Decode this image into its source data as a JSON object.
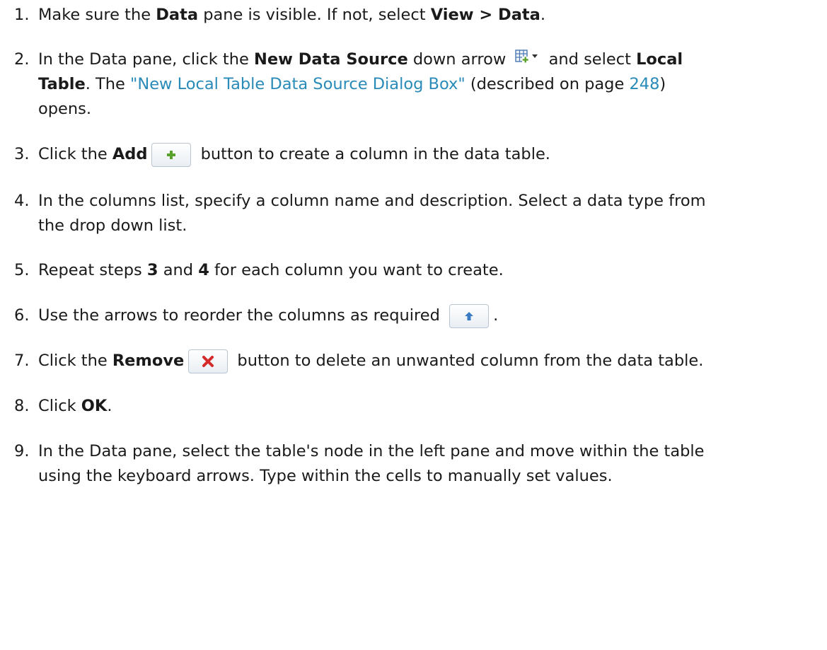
{
  "steps": [
    {
      "num": "1.",
      "a": "Make sure the ",
      "b": "Data",
      "c": " pane is visible. If not, select ",
      "d": "View > Data",
      "e": "."
    },
    {
      "num": "2.",
      "a": "In the Data pane, click the ",
      "b": "New Data Source",
      "c": " down arrow ",
      "d": " and select ",
      "e": "Local",
      "f": "Table",
      "g": ". The ",
      "link": "\"New Local Table Data Source Dialog Box\"",
      "h": " (described on page ",
      "page": "248",
      "i": ")",
      "j": "opens."
    },
    {
      "num": "3.",
      "a": "Click the ",
      "b": "Add",
      "c": " button to create a column in the data table."
    },
    {
      "num": "4.",
      "a": "In the columns list, specify a column name and description. Select a data type from",
      "b": "the drop down list."
    },
    {
      "num": "5.",
      "a": "Repeat steps ",
      "b": "3",
      "c": " and ",
      "d": "4",
      "e": " for each column you want to create."
    },
    {
      "num": "6.",
      "a": "Use the arrows to reorder the columns as required ",
      "b": "."
    },
    {
      "num": "7.",
      "a": "Click the ",
      "b": "Remove",
      "c": " button to delete an unwanted column from the data table."
    },
    {
      "num": "8.",
      "a": "Click ",
      "b": "OK",
      "c": "."
    },
    {
      "num": "9.",
      "a": "In the Data pane, select the table's node in the left pane and move within the table",
      "b": "using the keyboard arrows. Type within the cells to manually set values."
    }
  ],
  "icons": {
    "new_data_source": "table-add-icon",
    "add": "plus-icon",
    "move_up": "arrow-up-icon",
    "remove": "red-x-icon"
  },
  "colors": {
    "text": "#1a1a1a",
    "link": "#2a8ab8",
    "plus": "#5aa02c",
    "remove": "#d42a2a",
    "arrow": "#3a7cc4"
  }
}
